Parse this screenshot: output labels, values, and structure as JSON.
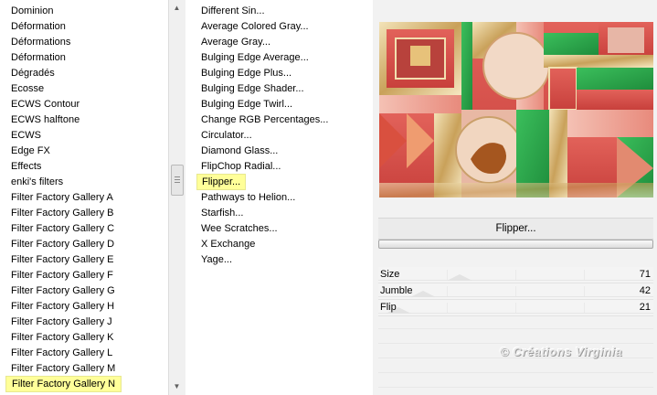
{
  "categories": {
    "items": [
      "Dominion",
      "Déformation",
      "Déformations",
      "Déformation",
      "Dégradés",
      "Ecosse",
      "ECWS Contour",
      "ECWS halftone",
      "ECWS",
      "Edge FX",
      "Effects",
      "enki's filters",
      "Filter Factory Gallery A",
      "Filter Factory Gallery B",
      "Filter Factory Gallery C",
      "Filter Factory Gallery D",
      "Filter Factory Gallery E",
      "Filter Factory Gallery F",
      "Filter Factory Gallery G",
      "Filter Factory Gallery H",
      "Filter Factory Gallery J",
      "Filter Factory Gallery K",
      "Filter Factory Gallery L",
      "Filter Factory Gallery M",
      "Filter Factory Gallery N"
    ],
    "selected": "Filter Factory Gallery N"
  },
  "filters": {
    "items": [
      "Different Sin...",
      "Average Colored Gray...",
      "Average Gray...",
      "Bulging Edge Average...",
      "Bulging Edge Plus...",
      "Bulging Edge Shader...",
      "Bulging Edge Twirl...",
      "Change RGB Percentages...",
      "Circulator...",
      "Diamond Glass...",
      "FlipChop Radial...",
      "Flipper...",
      "Pathways to Helion...",
      "Starfish...",
      "Wee Scratches...",
      "X Exchange",
      "Yage..."
    ],
    "selected": "Flipper..."
  },
  "filter_button": {
    "label": "Flipper..."
  },
  "parameters": [
    {
      "name": "Size",
      "value": "71"
    },
    {
      "name": "Jumble",
      "value": "42"
    },
    {
      "name": "Flip",
      "value": "21"
    }
  ],
  "watermark": "© Créations Virginia",
  "colors": {
    "selection_highlight": "#ffff99",
    "preview_red": "#d9534f",
    "preview_green": "#2fa84f",
    "preview_gold": "#d8b678"
  }
}
